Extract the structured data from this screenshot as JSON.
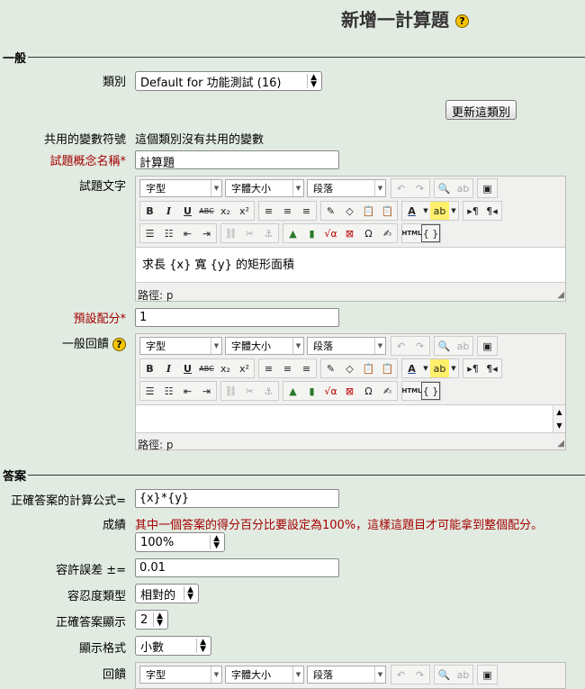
{
  "page": {
    "title": "新增一計算題",
    "help": "?"
  },
  "general": {
    "legend": "一般",
    "category_label": "類別",
    "category_value": "Default for 功能測試 (16)",
    "update_category_btn": "更新這類別",
    "shared_vars_label": "共用的變數符號",
    "shared_vars_value": "這個類別沒有共用的變數",
    "question_name_label": "試題概念名稱",
    "question_name_value": "計算題",
    "question_text_label": "試題文字",
    "question_text_value": "求長 {x} 寬 {y} 的矩形面積",
    "default_grade_label": "預設配分",
    "default_grade_value": "1",
    "feedback_label": "一般回饋",
    "required_star": "*"
  },
  "editor": {
    "font_family": "字型",
    "font_size": "字體大小",
    "format": "段落",
    "path_label": "路徑: p"
  },
  "answers": {
    "legend": "答案",
    "formula_label": "正確答案的計算公式=",
    "formula_value": "{x}*{y}",
    "grade_label": "成績",
    "grade_error": "其中一個答案的得分百分比要設定為100%，這樣這題目才可能拿到整個配分。",
    "grade_value": "100%",
    "tolerance_label": "容許誤差 ±=",
    "tolerance_value": "0.01",
    "tolerance_type_label": "容忍度類型",
    "tolerance_type_value": "相對的",
    "display_label": "正確答案顯示",
    "display_value": "2",
    "format_label": "顯示格式",
    "format_value": "小數",
    "feedback_label": "回饋"
  }
}
